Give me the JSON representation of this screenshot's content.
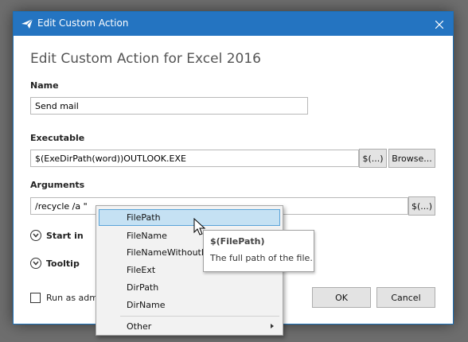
{
  "window": {
    "title": "Edit Custom Action",
    "heading": "Edit Custom Action for Excel 2016"
  },
  "name": {
    "label": "Name",
    "value": "Send mail"
  },
  "executable": {
    "label": "Executable",
    "value": "$(ExeDirPath(word))OUTLOOK.EXE",
    "macro_button": "$(...)",
    "browse_button": "Browse..."
  },
  "arguments": {
    "label": "Arguments",
    "value": "/recycle /a \"",
    "macro_button": "$(...)"
  },
  "expanders": {
    "start_in": "Start in",
    "tooltip": "Tooltip"
  },
  "run_as_admin": {
    "label": "Run as adm",
    "checked": false
  },
  "buttons": {
    "ok": "OK",
    "cancel": "Cancel"
  },
  "macro_menu": {
    "items": [
      "FilePath",
      "FileName",
      "FileNameWithoutE",
      "FileExt",
      "DirPath",
      "DirName"
    ],
    "selected": "FilePath",
    "other": "Other"
  },
  "tooltip": {
    "title": "$(FilePath)",
    "description": "The full path of the file."
  },
  "colors": {
    "titlebar": "#2474c1",
    "selection": "#c5e1f3",
    "selection_border": "#5aa3d8"
  }
}
